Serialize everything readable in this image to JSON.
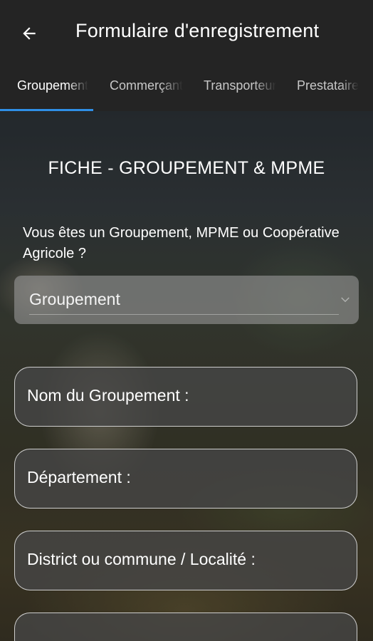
{
  "appbar": {
    "title": "Formulaire d'enregistrement",
    "back_icon": "arrow-left-icon"
  },
  "tabs": [
    {
      "label": "Groupement",
      "active": true
    },
    {
      "label": "Commerçant",
      "active": false
    },
    {
      "label": "Transporteur",
      "active": false
    },
    {
      "label": "Prestataire",
      "active": false
    }
  ],
  "form": {
    "title": "FICHE - GROUPEMENT & MPME",
    "question": "Vous êtes un Groupement, MPME ou Coopérative Agricole ?",
    "select": {
      "value": "Groupement",
      "chevron_icon": "chevron-down-icon"
    },
    "fields": [
      {
        "label": "Nom du Groupement :"
      },
      {
        "label": "Département :"
      },
      {
        "label": "District ou commune / Localité :"
      },
      {
        "label": ""
      }
    ]
  },
  "colors": {
    "appbar": "#242424",
    "tab_indicator": "#2f8fe6",
    "text": "#ffffff"
  }
}
